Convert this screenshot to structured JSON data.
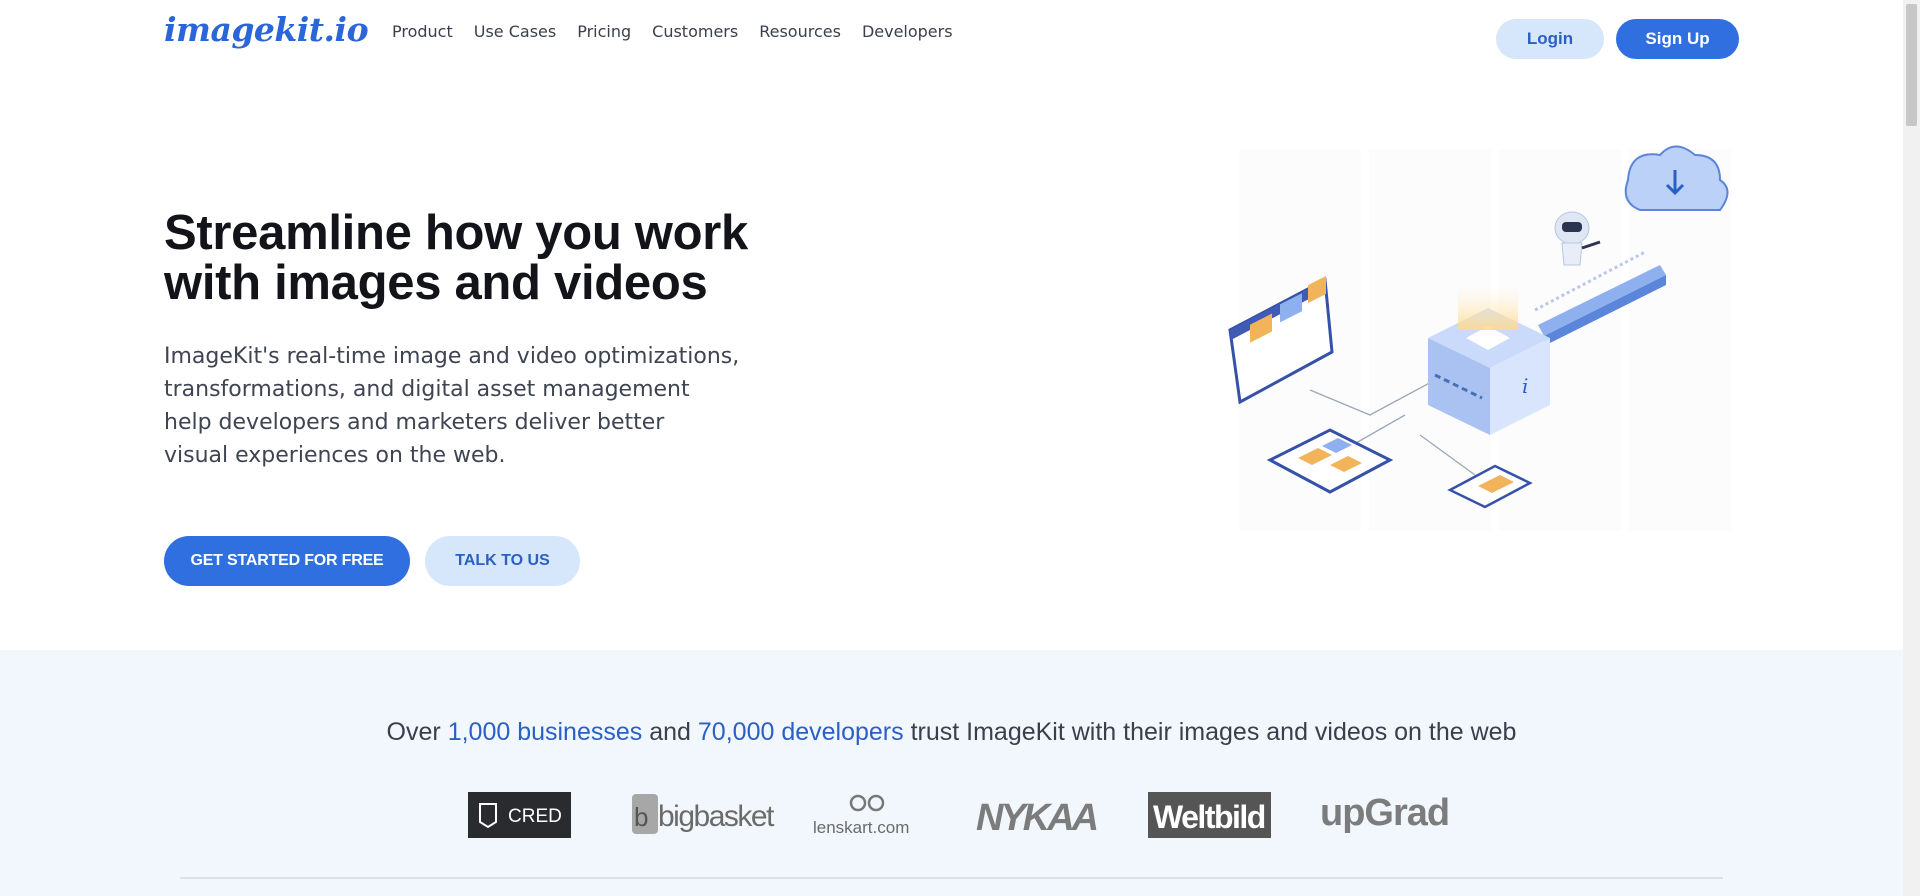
{
  "nav": {
    "logo": "imagekit.io",
    "items": [
      "Product",
      "Use Cases",
      "Pricing",
      "Customers",
      "Resources",
      "Developers"
    ],
    "login": "Login",
    "signup": "Sign Up"
  },
  "hero": {
    "title_line1": "Streamline how you work",
    "title_line2": "with images and videos",
    "sub_lines": [
      "ImageKit's real-time image and video optimizations,",
      "transformations, and digital asset management",
      "help developers and marketers deliver better",
      "visual experiences on the web."
    ],
    "cta_primary": "GET STARTED FOR FREE",
    "cta_secondary": "TALK TO US"
  },
  "trust": {
    "prefix": "Over",
    "businesses": "1,000 businesses",
    "and": "and",
    "developers": "70,000 developers",
    "suffix": "trust ImageKit with their images and videos on the web",
    "logos": [
      "CRED",
      "bigbasket",
      "lenskart.com",
      "NYKAA",
      "Weltbild",
      "upGrad"
    ]
  },
  "colors": {
    "accent": "#2f6fdf",
    "accent_light": "#d6e6fb",
    "section_bg": "#f2f7fd"
  }
}
